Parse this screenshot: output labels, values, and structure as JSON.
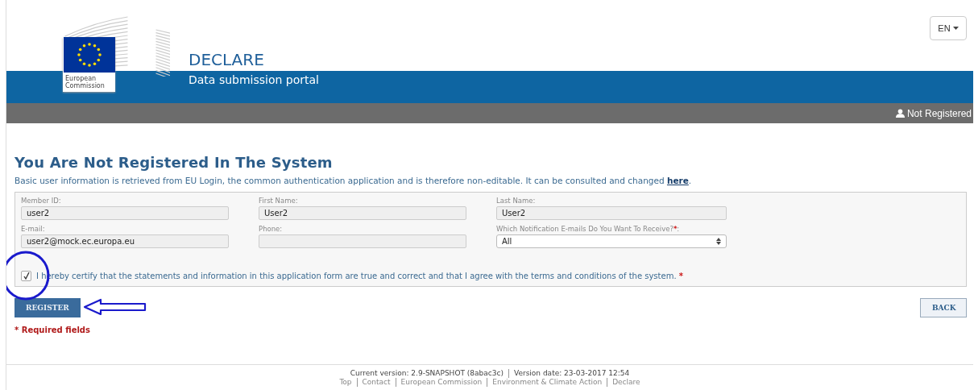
{
  "header": {
    "logo_text": [
      "European",
      "Commission"
    ],
    "app_title": "DECLARE",
    "app_subtitle": "Data submission portal",
    "language": "EN"
  },
  "user_bar": {
    "status": "Not Registered"
  },
  "page": {
    "heading": "You Are Not Registered In The System",
    "intro": "Basic user information is retrieved from EU Login, the common authentication application and is therefore non-editable. It can be consulted and changed ",
    "intro_link": "here",
    "intro_end": "."
  },
  "form": {
    "rows": [
      [
        {
          "kind": "text",
          "label": "Member ID:",
          "value": "user2",
          "disabled": true
        },
        {
          "kind": "text",
          "label": "First Name:",
          "value": "User2",
          "disabled": true
        },
        {
          "kind": "text",
          "label": "Last Name:",
          "value": "User2",
          "disabled": true
        }
      ],
      [
        {
          "kind": "text",
          "label": "E-mail:",
          "value": "user2@mock.ec.europa.eu",
          "disabled": true
        },
        {
          "kind": "text",
          "label": "Phone:",
          "disabled": true
        },
        {
          "kind": "select",
          "label": "Which Notification E-mails Do You Want To Receive?",
          "required_mark": "*",
          "label_end": ":",
          "value": "All",
          "disabled": false
        }
      ]
    ],
    "certify": {
      "checked": true,
      "text": "I hereby certify that the statements and information in this application form are true and correct and that I agree with the terms and conditions of the system.",
      "required_mark": "*"
    }
  },
  "buttons": {
    "register": "REGISTER",
    "back": "BACK"
  },
  "required_note": "* Required fields",
  "footer": {
    "version": "Current version: 2.9-SNAPSHOT (8abac3c)",
    "date": "Version date: 23-03-2017 12:54",
    "links": [
      "Top",
      "Contact",
      "European Commission",
      "Environment & Climate Action",
      "Declare"
    ]
  }
}
